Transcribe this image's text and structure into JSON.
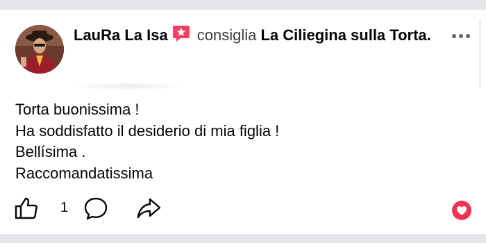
{
  "post": {
    "author": "LauRa La Isa",
    "verb": "consiglia",
    "page_name": "La Ciliegina sulla Torta.",
    "body_lines": [
      "Torta buonissima !",
      "Ha soddisfatto il desiderio di mia figlia !",
      "Bellísima .",
      "Raccomandatissima"
    ],
    "like_count": "1",
    "icons": {
      "badge": "recommend-star-icon",
      "more": "more-options-icon",
      "like": "thumbs-up-icon",
      "comment": "comment-icon",
      "share": "share-icon",
      "reaction": "love-reaction-icon"
    },
    "colors": {
      "badge": "#f3425f",
      "reaction": "#f0334f",
      "icon_stroke": "#65676b",
      "text": "#050505"
    }
  }
}
